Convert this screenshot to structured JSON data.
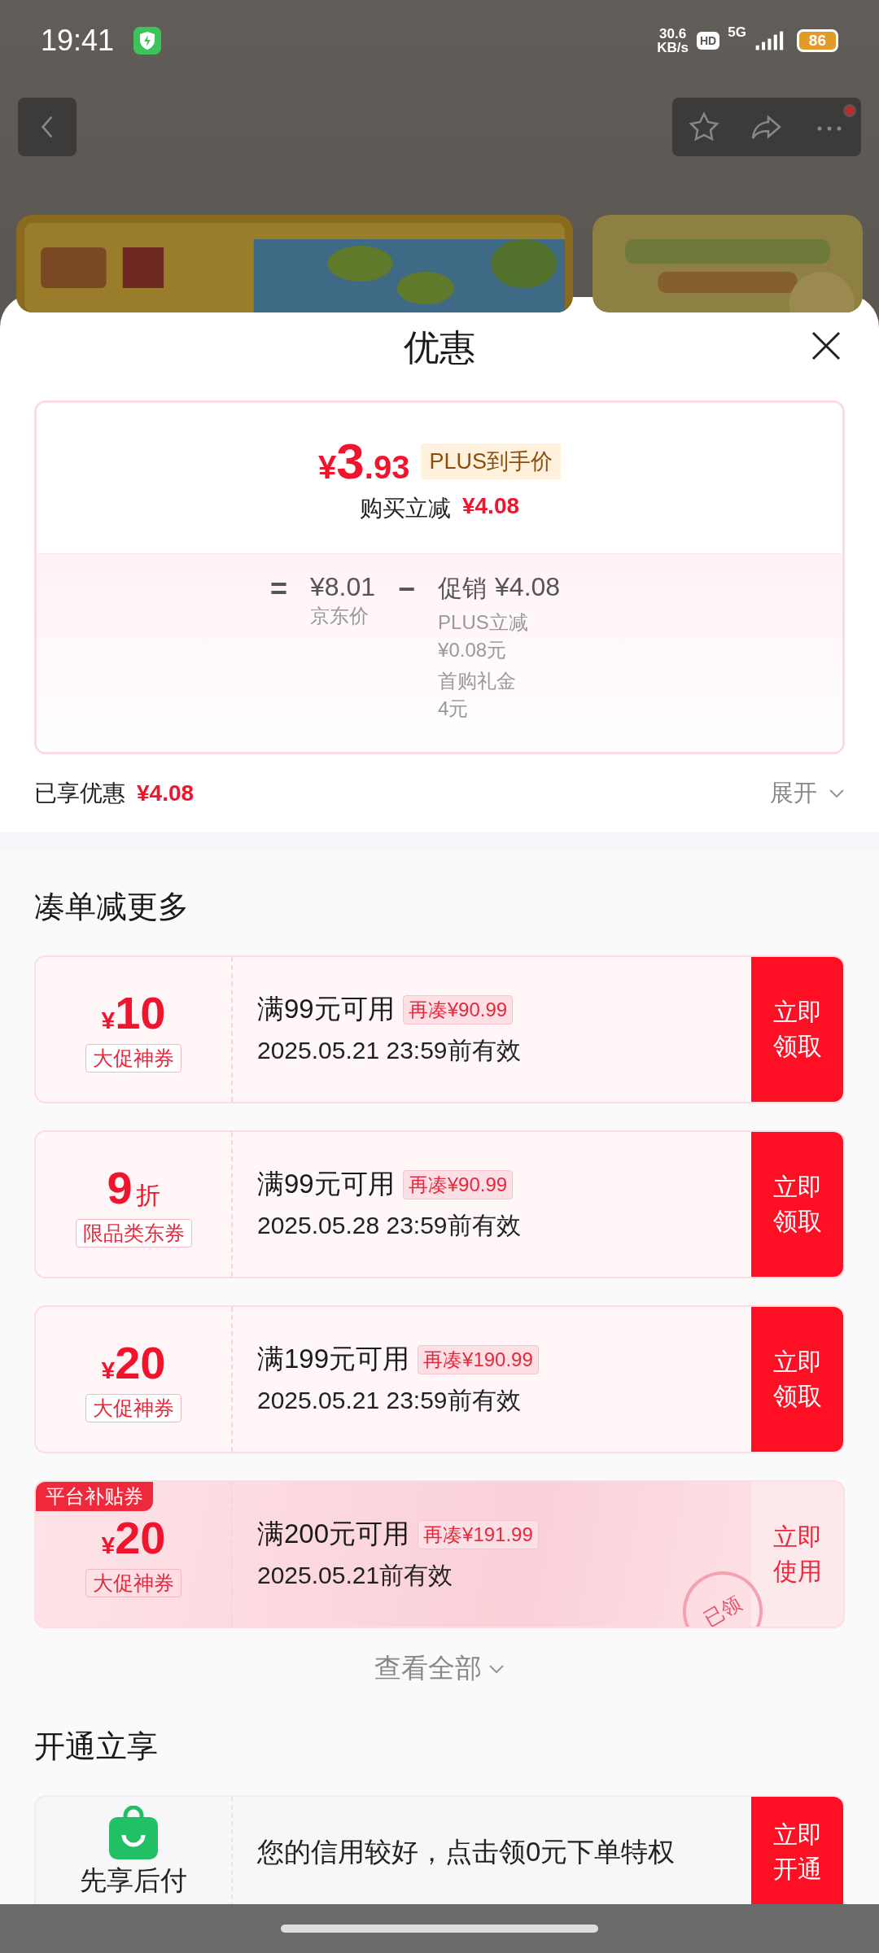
{
  "status_bar": {
    "time": "19:41",
    "speed_value": "30.6",
    "speed_unit": "KB/s",
    "hd": "HD",
    "network": "5G",
    "battery": "86"
  },
  "sheet": {
    "title": "优惠",
    "price": {
      "currency": "¥",
      "integer": "3",
      "decimal": ".93",
      "tag": "PLUS到手价"
    },
    "instant": {
      "label": "购买立减",
      "amount": "¥4.08"
    },
    "breakdown": {
      "equals": "=",
      "base_amount": "¥8.01",
      "base_label": "京东价",
      "minus": "−",
      "promo_label": "促销",
      "promo_amount": "¥4.08",
      "items": [
        {
          "name": "PLUS立减",
          "value": "¥0.08元"
        },
        {
          "name": "首购礼金",
          "value": "4元"
        }
      ]
    },
    "enjoyed": {
      "label": "已享优惠",
      "amount": "¥4.08"
    },
    "expand": "展开"
  },
  "coupon_section": {
    "title": "凑单减更多",
    "coupons": [
      {
        "kind": "amount",
        "currency": "¥",
        "value": "10",
        "tag": "大促神券",
        "condition": "满99元可用",
        "gap": "再凑¥90.99",
        "validity": "2025.05.21 23:59前有效",
        "action": "立即领取",
        "claimed": false
      },
      {
        "kind": "discount",
        "value": "9",
        "unit": "折",
        "tag": "限品类东券",
        "condition": "满99元可用",
        "gap": "再凑¥90.99",
        "validity": "2025.05.28 23:59前有效",
        "action": "立即领取",
        "claimed": false
      },
      {
        "kind": "amount",
        "currency": "¥",
        "value": "20",
        "tag": "大促神券",
        "condition": "满199元可用",
        "gap": "再凑¥190.99",
        "validity": "2025.05.21 23:59前有效",
        "action": "立即领取",
        "claimed": false
      },
      {
        "kind": "amount",
        "badge": "平台补贴券",
        "currency": "¥",
        "value": "20",
        "tag": "大促神券",
        "condition": "满200元可用",
        "gap": "再凑¥191.99",
        "validity": "2025.05.21前有效",
        "action": "立即使用",
        "claimed": true,
        "stamp": "已领"
      }
    ],
    "view_all": "查看全部"
  },
  "offer_section": {
    "title": "开通立享",
    "name": "先享后付",
    "text": "您的信用较好，点击领0元下单特权",
    "action": "立即开通"
  }
}
